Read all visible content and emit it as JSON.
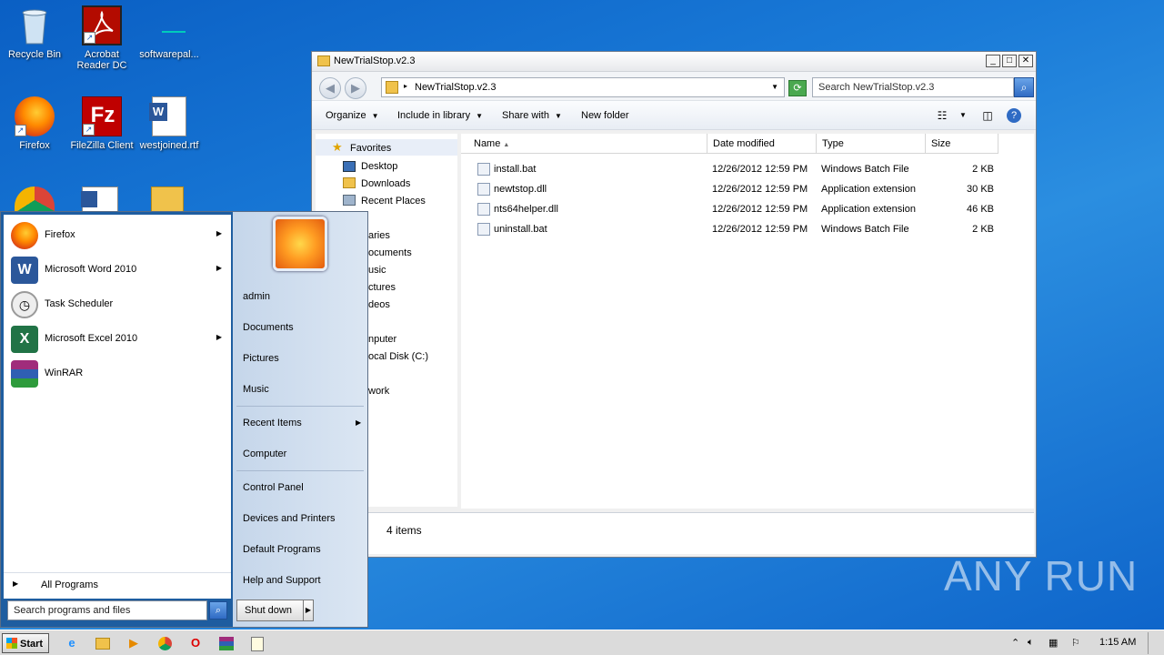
{
  "desktop": {
    "icons": [
      {
        "label": "Recycle Bin",
        "icon": "recycle-bin-icon"
      },
      {
        "label": "Acrobat Reader DC",
        "icon": "acrobat-icon"
      },
      {
        "label": "softwarepal...",
        "icon": "blank-file-icon"
      },
      {
        "label": "Firefox",
        "icon": "firefox-icon"
      },
      {
        "label": "FileZilla Client",
        "icon": "filezilla-icon"
      },
      {
        "label": "westjoined.rtf",
        "icon": "word-doc-icon"
      }
    ],
    "watermark": "ANY  RUN"
  },
  "explorer": {
    "title": "NewTrialStop.v2.3",
    "address": "NewTrialStop.v2.3",
    "search_placeholder": "Search NewTrialStop.v2.3",
    "toolbar": {
      "organize": "Organize",
      "include_in_library": "Include in library",
      "share_with": "Share with",
      "new_folder": "New folder"
    },
    "nav": {
      "favorites": "Favorites",
      "desktop": "Desktop",
      "downloads": "Downloads",
      "recent_places": "Recent Places",
      "libraries": "aries",
      "documents": "ocuments",
      "music": "usic",
      "pictures": "ctures",
      "videos": "deos",
      "computer": "nputer",
      "local_disk": "ocal Disk (C:)",
      "network": "work"
    },
    "columns": {
      "name": "Name",
      "date_modified": "Date modified",
      "type": "Type",
      "size": "Size"
    },
    "files": [
      {
        "name": "install.bat",
        "date": "12/26/2012 12:59 PM",
        "type": "Windows Batch File",
        "size": "2 KB"
      },
      {
        "name": "newtstop.dll",
        "date": "12/26/2012 12:59 PM",
        "type": "Application extension",
        "size": "30 KB"
      },
      {
        "name": "nts64helper.dll",
        "date": "12/26/2012 12:59 PM",
        "type": "Application extension",
        "size": "46 KB"
      },
      {
        "name": "uninstall.bat",
        "date": "12/26/2012 12:59 PM",
        "type": "Windows Batch File",
        "size": "2 KB"
      }
    ],
    "status": "4 items"
  },
  "start_menu": {
    "programs": [
      {
        "label": "Firefox",
        "icon": "firefox-icon",
        "color": "#e66000"
      },
      {
        "label": "Microsoft Word 2010",
        "icon": "word-icon",
        "color": "#2b579a"
      },
      {
        "label": "Task Scheduler",
        "icon": "clock-icon",
        "color": "#c8c8c8"
      },
      {
        "label": "Microsoft Excel 2010",
        "icon": "excel-icon",
        "color": "#217346"
      },
      {
        "label": "WinRAR",
        "icon": "winrar-icon",
        "color": "#7b2f8c"
      }
    ],
    "all_programs": "All Programs",
    "search_placeholder": "Search programs and files",
    "right": {
      "user": "admin",
      "documents": "Documents",
      "pictures": "Pictures",
      "music": "Music",
      "recent_items": "Recent Items",
      "computer": "Computer",
      "control_panel": "Control Panel",
      "devices_printers": "Devices and Printers",
      "default_programs": "Default Programs",
      "help_support": "Help and Support"
    },
    "shutdown": "Shut down"
  },
  "taskbar": {
    "start": "Start",
    "clock": "1:15 AM"
  }
}
